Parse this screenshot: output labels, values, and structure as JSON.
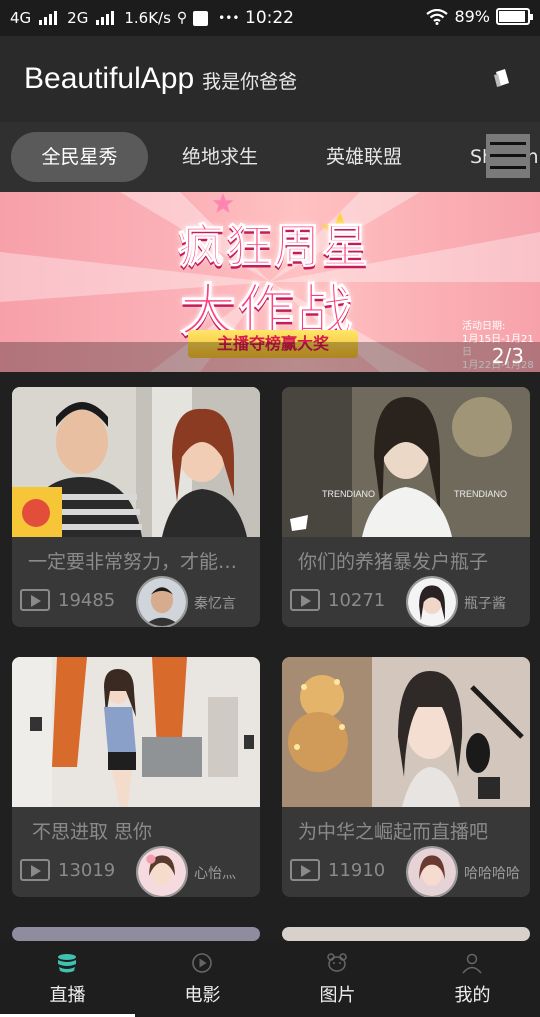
{
  "status_bar": {
    "network1": "4G",
    "network2": "2G",
    "speed": "1.6K/s",
    "dots": "•••",
    "time": "10:22",
    "battery": "89%"
  },
  "app_bar": {
    "title": "BeautifulApp",
    "subtitle": "我是你爸爸"
  },
  "tabs": [
    {
      "label": "全民星秀",
      "active": true
    },
    {
      "label": "绝地求生",
      "active": false
    },
    {
      "label": "英雄联盟",
      "active": false
    },
    {
      "label": "Showin",
      "active": false
    }
  ],
  "banner": {
    "headline_line1": "疯狂周星",
    "headline_line2": "大作战",
    "ribbon": "主播夺榜赢大奖",
    "info_line1": "活动日期:",
    "info_line2": "1月15日-1月21日",
    "info_line3": "1月22日-1月28日",
    "indicator": "2/3"
  },
  "streams": [
    {
      "title": "一定要非常努力，才能看起来毫不费力",
      "views": "19485",
      "anchor": "秦忆言"
    },
    {
      "title": "你们的养猪暴发户瓶子",
      "views": "10271",
      "anchor": "瓶子酱"
    },
    {
      "title": "不思进取 思你",
      "views": "13019",
      "anchor": "心怡灬"
    },
    {
      "title": "为中华之崛起而直播吧",
      "views": "11910",
      "anchor": "哈哈哈哈"
    }
  ],
  "thumb_text": {
    "brand": "TRENDIANO",
    "brand2": "TRENDIANO"
  },
  "bottom_nav": [
    {
      "label": "直播",
      "icon": "live-cup-icon",
      "active": true
    },
    {
      "label": "电影",
      "icon": "movie-play-icon",
      "active": false
    },
    {
      "label": "图片",
      "icon": "bear-icon",
      "active": false
    },
    {
      "label": "我的",
      "icon": "person-icon",
      "active": false
    }
  ],
  "colors": {
    "accent": "#3fc2b0",
    "background": "#202020",
    "card": "#383838",
    "banner_pink": "#f7a0aa"
  }
}
